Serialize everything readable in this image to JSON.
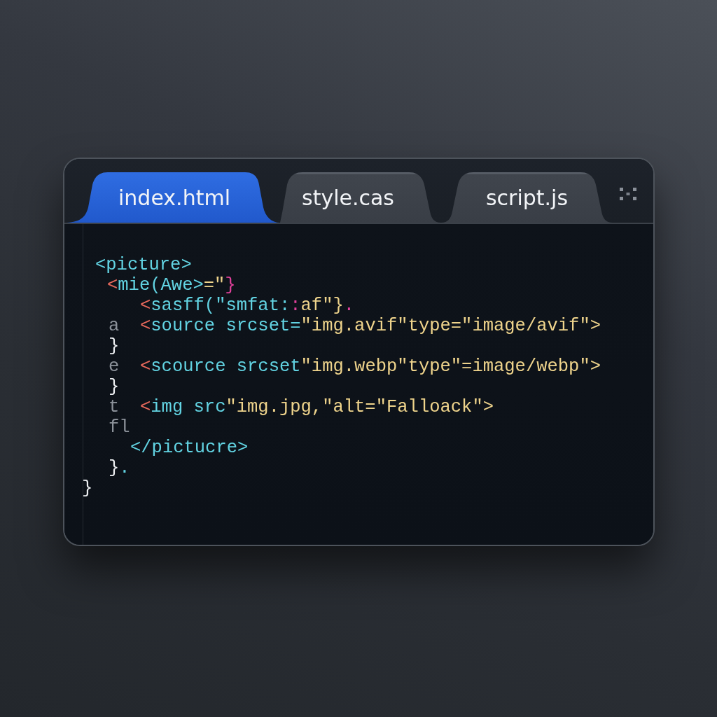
{
  "tabs": [
    {
      "label": "index.html",
      "selected": true
    },
    {
      "label": "style.cas",
      "selected": false
    },
    {
      "label": "script.js",
      "selected": false
    }
  ],
  "code_lines": [
    {
      "tokens": [
        {
          "kind": "tag",
          "text": "<picture>"
        }
      ]
    },
    {
      "tokens": [
        {
          "kind": "bracket",
          "text": "<"
        },
        {
          "kind": "tag",
          "text": "mie(Awe>"
        },
        {
          "kind": "string",
          "text": "=\""
        },
        {
          "kind": "punct",
          "text": "}"
        }
      ]
    },
    {
      "tokens": [
        {
          "kind": "bracket",
          "text": "<"
        },
        {
          "kind": "tag",
          "text": "sasff(\"smfat:"
        },
        {
          "kind": "punct",
          "text": ":"
        },
        {
          "kind": "string",
          "text": "af\"}"
        },
        {
          "kind": "punct",
          "text": "."
        }
      ]
    },
    {
      "gutter": "a",
      "tokens": [
        {
          "kind": "bracket",
          "text": "<"
        },
        {
          "kind": "tag",
          "text": "source srcset="
        },
        {
          "kind": "string",
          "text": "\"img.avif\"type=\"image/avif\">"
        }
      ]
    },
    {
      "tokens": [
        {
          "kind": "plain",
          "text": "}"
        }
      ]
    },
    {
      "gutter": "e",
      "tokens": [
        {
          "kind": "bracket",
          "text": "<"
        },
        {
          "kind": "tag",
          "text": "scource srcset"
        },
        {
          "kind": "string",
          "text": "\"img.webp\"type\"=image/webp\">"
        }
      ]
    },
    {
      "tokens": [
        {
          "kind": "plain",
          "text": "}"
        }
      ]
    },
    {
      "gutter": "t",
      "tokens": [
        {
          "kind": "bracket",
          "text": "<"
        },
        {
          "kind": "tag",
          "text": "img src"
        },
        {
          "kind": "string",
          "text": "\"img.jpg,\"alt=\"Falloack\">"
        }
      ]
    },
    {
      "gutter": "fl"
    },
    {
      "tokens": [
        {
          "kind": "tag",
          "text": "</pictucre>"
        }
      ]
    },
    {
      "tokens": [
        {
          "kind": "plain",
          "text": "}"
        },
        {
          "kind": "tag",
          "text": "."
        }
      ]
    },
    {
      "tokens": [
        {
          "kind": "plain",
          "text": "}"
        }
      ]
    }
  ]
}
